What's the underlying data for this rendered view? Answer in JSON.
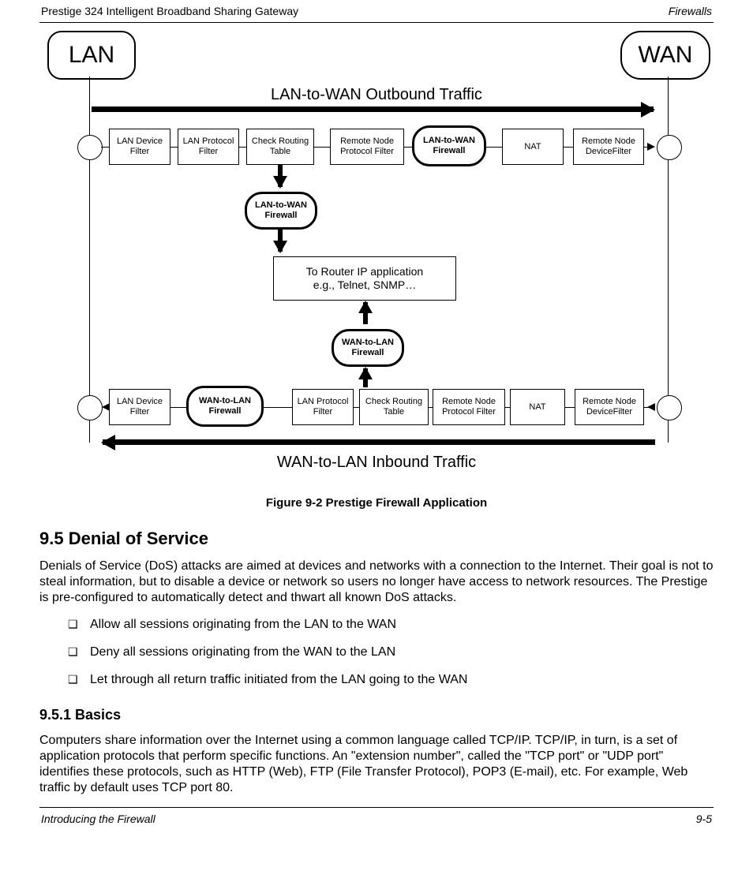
{
  "header": {
    "left": "Prestige 324 Intelligent Broadband Sharing Gateway",
    "right": "Firewalls"
  },
  "footer": {
    "left": "Introducing the Firewall",
    "right": "9-5"
  },
  "figure_caption": "Figure 9-2 Prestige Firewall Application",
  "section_title": "9.5 Denial of Service",
  "paragraph": "Denials of Service (DoS) attacks are aimed at devices and networks with a connection to the Internet. Their goal is not to steal information, but to disable a device or network so users no longer have access to network resources. The Prestige is pre-configured to automatically detect and thwart all known DoS attacks.",
  "subsection_title": "9.5.1 Basics",
  "subsection_intro": "Computers share information over the Internet using a common language called TCP/IP. TCP/IP, in turn, is a set of application protocols that perform specific functions. An \"extension number\", called the \"TCP port\" or \"UDP port\" identifies these protocols, such as HTTP (Web), FTP (File Transfer Protocol), POP3 (E-mail), etc. For example, Web traffic by default uses TCP port 80.",
  "diagram": {
    "lan": "LAN",
    "wan": "WAN",
    "out_title": "LAN-to-WAN Outbound Traffic",
    "in_title": "WAN-to-LAN Inbound Traffic",
    "top_row": {
      "b1": "LAN Device Filter",
      "b2": "LAN Protocol Filter",
      "b3": "Check Routing Table",
      "b4": "Remote Node Protocol Filter",
      "b5": "LAN-to-WAN Firewall",
      "b6": "NAT",
      "b7": "Remote Node DeviceFilter"
    },
    "mid": {
      "fw_top": "LAN-to-WAN Firewall",
      "app_line1": "To Router IP application",
      "app_line2": "e.g., Telnet, SNMP…",
      "fw_bot": "WAN-to-LAN Firewall"
    },
    "bot_row": {
      "b1": "LAN Device Filter",
      "b2": "WAN-to-LAN Firewall",
      "b3": "LAN Protocol Filter",
      "b4": "Check Routing Table",
      "b5": "Remote Node Protocol Filter",
      "b6": "NAT",
      "b7": "Remote Node DeviceFilter"
    }
  },
  "bullets": [
    "Allow all sessions originating from the LAN to the WAN",
    "Deny all sessions originating from the WAN to the LAN",
    "Let through all return traffic initiated from the LAN going to the WAN"
  ]
}
